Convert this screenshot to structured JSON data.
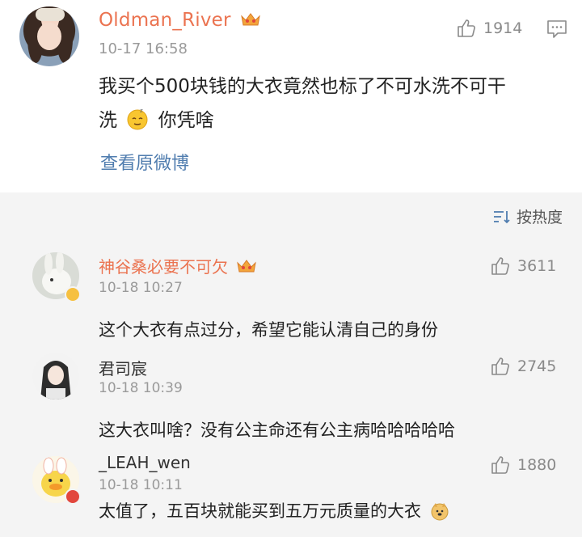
{
  "post": {
    "username": "Oldman_River",
    "time": "10-17 16:58",
    "likes": "1914",
    "text_line1": "我买个500块钱的大衣竟然也标了不可水洗不可干",
    "text_line2_a": "洗",
    "text_line2_b": "你凭啥",
    "view_original": "查看原微博"
  },
  "sort": {
    "label": "按热度"
  },
  "comments": [
    {
      "username": "神谷桑必要不可欠",
      "time": "10-18 10:27",
      "likes": "3611",
      "text": "这个大衣有点过分，希望它能认清自己的身份",
      "name_color": "#eb7350"
    },
    {
      "username": "君司宸",
      "time": "10-18 10:39",
      "likes": "2745",
      "text": "这大衣叫啥？没有公主命还有公主病哈哈哈哈哈",
      "name_color": "#333333"
    },
    {
      "username": "_LEAH_wen",
      "time": "10-18 10:11",
      "likes": "1880",
      "text": "太值了，五百块就能买到五万元质量的大衣",
      "name_color": "#333333"
    }
  ],
  "colors": {
    "accent": "#eb7350",
    "link": "#507daf",
    "muted": "#9a9a9a",
    "background": "#f4f4f4"
  }
}
